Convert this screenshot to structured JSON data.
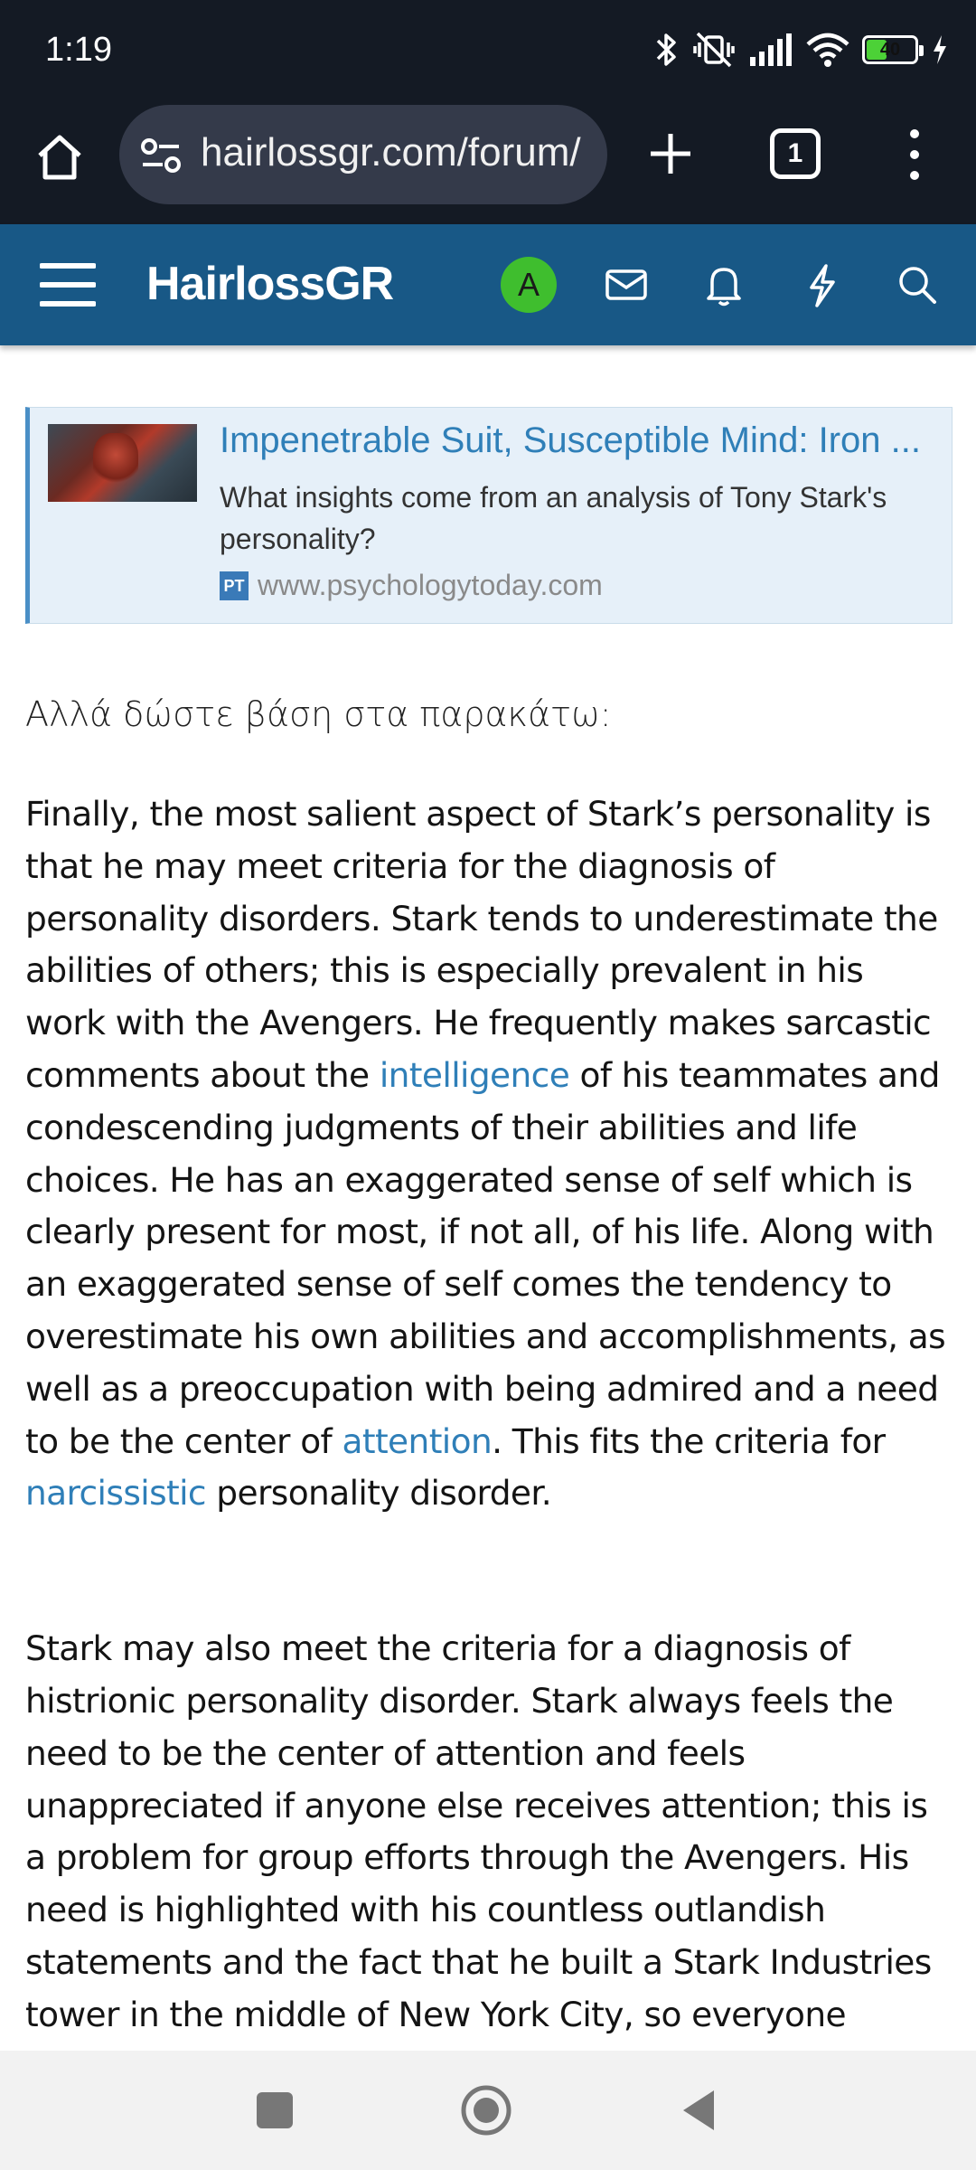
{
  "status_bar": {
    "time": "1:19",
    "battery_level": "40",
    "icons": [
      "bluetooth-icon",
      "vibrate-off-icon",
      "signal-icon",
      "wifi-icon",
      "battery-icon",
      "charging-icon"
    ]
  },
  "browser": {
    "url": "hairlossgr.com/forum/",
    "tab_count": "1"
  },
  "forum_header": {
    "logo": "HairlossGR",
    "avatar_initial": "A",
    "colors": {
      "header_bg": "#185886",
      "avatar_bg": "#3fbe2e"
    }
  },
  "link_card": {
    "title": "Impenetrable Suit, Susceptible Mind: Iron ...",
    "description": "What insights come from an analysis of Tony Stark's personality?",
    "source_icon": "PT",
    "source": "www.psychologytoday.com"
  },
  "post": {
    "intro": "Αλλά δώστε βάση στα παρακάτω:",
    "paragraph1": {
      "part1": "Finally, the most salient aspect of Stark’s personality is that he may meet criteria for the diagnosis of personality disorders. Stark tends to underestimate the abilities of others; this is especially prevalent in his work with the Avengers. He frequently makes sarcastic comments about the ",
      "link1": "intelligence",
      "part2": " of his teammates and condescending judgments of their abilities and life choices. He has an exaggerated sense of self which is clearly present for most, if not all, of his life. Along with an exaggerated sense of self comes the tendency to overestimate his own abilities and accomplishments, as well as a preoccupation with being admired and a need to be the center of ",
      "link2": "attention",
      "part3": ". This fits the criteria for ",
      "link3": "narcissistic",
      "part4": " personality disorder."
    },
    "paragraph2": "Stark may also meet the criteria for a diagnosis of histrionic personality disorder. Stark always feels the need to be the center of attention and feels unappreciated if anyone else receives attention; this is a problem for group efforts through the Avengers. His need is highlighted with his countless outlandish statements and the fact that he built a Stark Industries tower in the middle of New York City, so everyone"
  },
  "nav_bar": {
    "buttons": [
      "recents-button",
      "home-button",
      "back-button"
    ]
  }
}
